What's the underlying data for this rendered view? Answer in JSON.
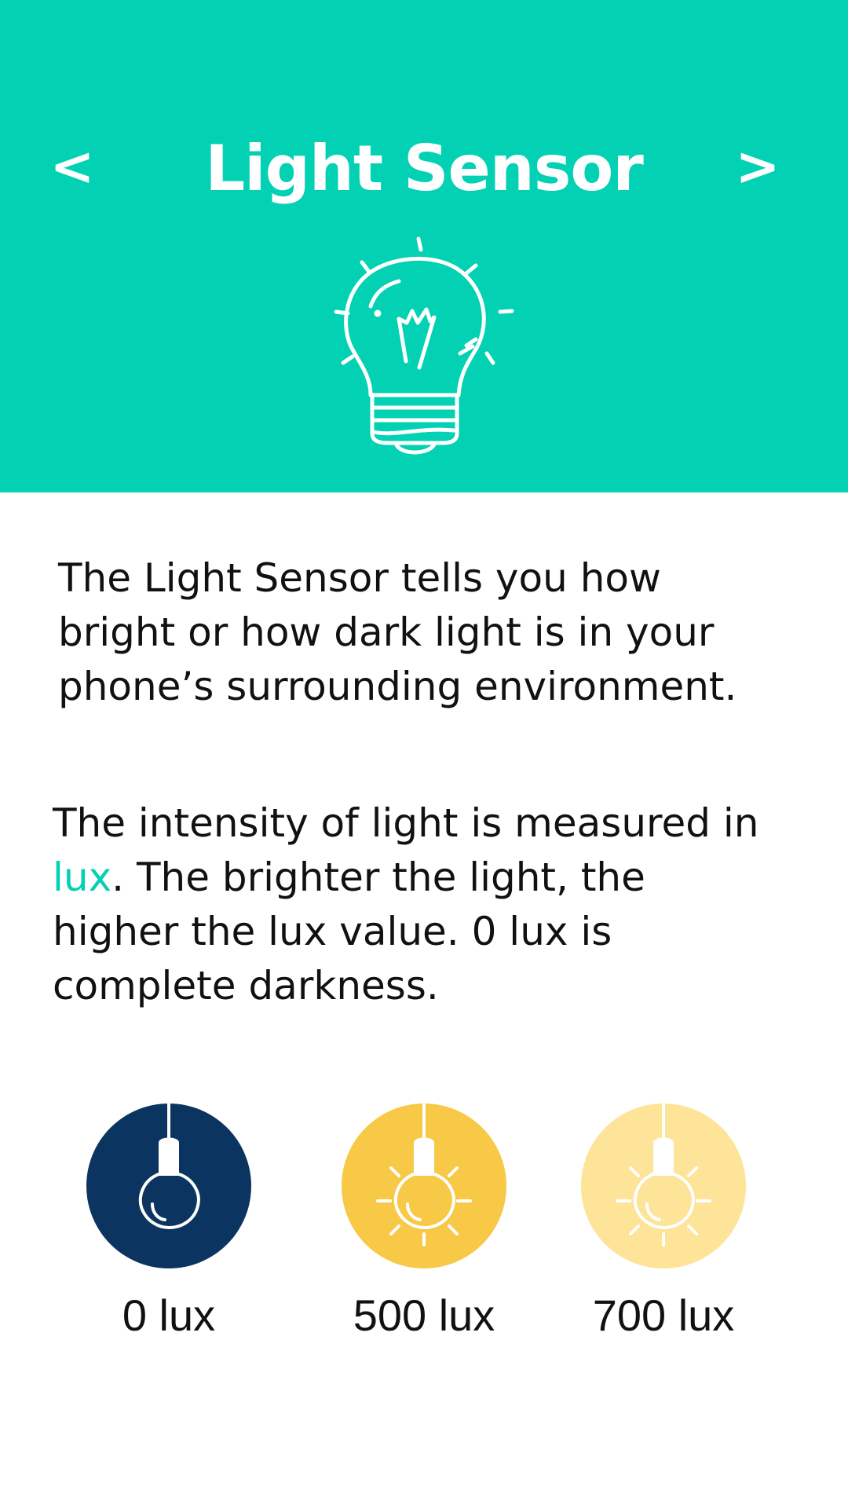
{
  "header": {
    "title": "Light Sensor",
    "prev_label": "<",
    "next_label": ">",
    "background_color": "#03d1b3",
    "hero_icon": "lightbulb-outline-icon"
  },
  "body": {
    "para1_lines": [
      "The Light Sensor tells you how",
      "bright or how dark light is in your",
      "phone’s surrounding environment."
    ],
    "para2": {
      "line1": "The intensity of light is measured in",
      "highlight": "lux",
      "line2_rest": ". The brighter the light, the",
      "line3": "higher the lux value. 0 lux is",
      "line4": "complete darkness."
    }
  },
  "lux_examples": [
    {
      "label": "0 lux",
      "color": "#0b3560",
      "icon": "bulb-off-icon"
    },
    {
      "label": "500 lux",
      "color": "#f7c947",
      "icon": "bulb-bright-icon"
    },
    {
      "label": "700 lux",
      "color": "#fde498",
      "icon": "bulb-brighter-icon"
    }
  ]
}
